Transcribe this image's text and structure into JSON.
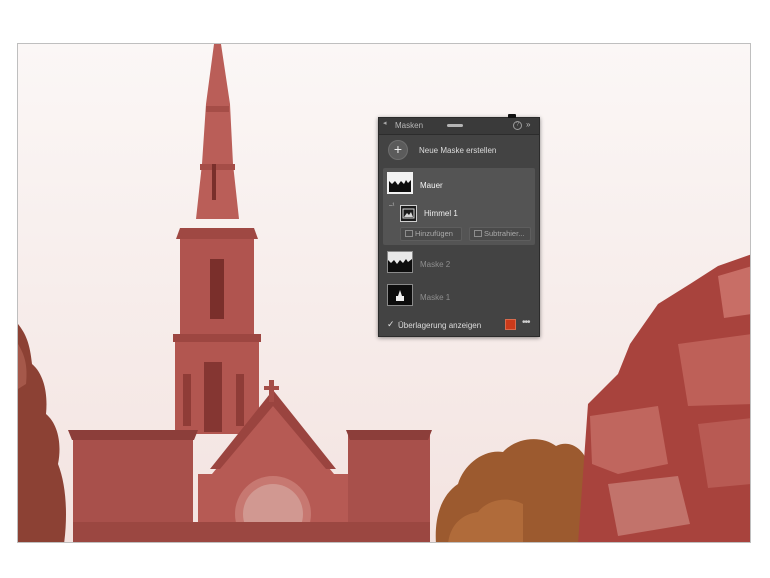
{
  "panel": {
    "title": "Masken",
    "help_icon": "question-circle-icon",
    "expand_icon": "double-chevron-right-icon",
    "new_mask_label": "Neue Maske erstellen",
    "active_mask": {
      "name": "Mauer",
      "component": "Himmel 1",
      "add_label": "Hinzufügen",
      "subtract_label": "Subtrahier..."
    },
    "masks": [
      {
        "name": "Maske 2"
      },
      {
        "name": "Maske 1"
      }
    ],
    "overlay": {
      "label": "Überlagerung anzeigen",
      "checked": true,
      "color": "#cc3a1a"
    }
  }
}
